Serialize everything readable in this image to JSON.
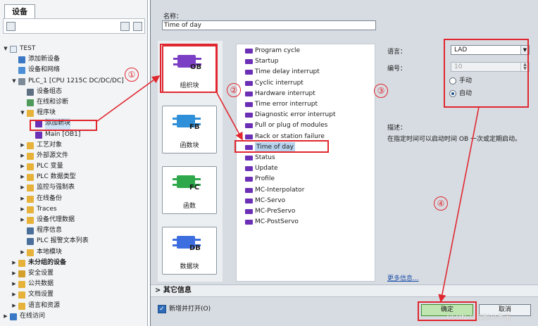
{
  "panel": {
    "title": "设备"
  },
  "tree": [
    {
      "label": "TEST",
      "arrow": "▼",
      "depth": 0,
      "icon": "project-icon"
    },
    {
      "label": "添加新设备",
      "arrow": "",
      "depth": 1,
      "icon": "add-device-icon"
    },
    {
      "label": "设备和网络",
      "arrow": "",
      "depth": 1,
      "icon": "network-icon"
    },
    {
      "label": "PLC_1 [CPU 1215C DC/DC/DC]",
      "arrow": "▼",
      "depth": 1,
      "icon": "plc-icon"
    },
    {
      "label": "设备组态",
      "arrow": "",
      "depth": 2,
      "icon": "device-config-icon"
    },
    {
      "label": "在线和诊断",
      "arrow": "",
      "depth": 2,
      "icon": "diagnostics-icon"
    },
    {
      "label": "程序块",
      "arrow": "▼",
      "depth": 2,
      "icon": "folder-icon"
    },
    {
      "label": "添加新块",
      "arrow": "",
      "depth": 3,
      "icon": "add-block-icon",
      "selected": true
    },
    {
      "label": "Main [OB1]",
      "arrow": "",
      "depth": 3,
      "icon": "ob-block-icon"
    },
    {
      "label": "工艺对象",
      "arrow": "▶",
      "depth": 2,
      "icon": "folder-icon"
    },
    {
      "label": "外部源文件",
      "arrow": "▶",
      "depth": 2,
      "icon": "folder-icon"
    },
    {
      "label": "PLC 变量",
      "arrow": "▶",
      "depth": 2,
      "icon": "folder-icon"
    },
    {
      "label": "PLC 数据类型",
      "arrow": "▶",
      "depth": 2,
      "icon": "folder-icon"
    },
    {
      "label": "监控与强制表",
      "arrow": "▶",
      "depth": 2,
      "icon": "folder-icon"
    },
    {
      "label": "在线备份",
      "arrow": "▶",
      "depth": 2,
      "icon": "folder-icon"
    },
    {
      "label": "Traces",
      "arrow": "▶",
      "depth": 2,
      "icon": "folder-icon"
    },
    {
      "label": "设备代理数据",
      "arrow": "▶",
      "depth": 2,
      "icon": "folder-icon"
    },
    {
      "label": "程序信息",
      "arrow": "",
      "depth": 2,
      "icon": "program-info-icon"
    },
    {
      "label": "PLC 报警文本列表",
      "arrow": "",
      "depth": 2,
      "icon": "alarm-list-icon"
    },
    {
      "label": "本地模块",
      "arrow": "▶",
      "depth": 2,
      "icon": "folder-icon"
    },
    {
      "label": "未分组的设备",
      "arrow": "▶",
      "depth": 1,
      "icon": "folder-icon",
      "bold": true
    },
    {
      "label": "安全设置",
      "arrow": "▶",
      "depth": 1,
      "icon": "security-icon"
    },
    {
      "label": "公共数据",
      "arrow": "▶",
      "depth": 1,
      "icon": "folder-icon"
    },
    {
      "label": "文档设置",
      "arrow": "▶",
      "depth": 1,
      "icon": "folder-icon"
    },
    {
      "label": "语言和资源",
      "arrow": "▶",
      "depth": 1,
      "icon": "folder-icon"
    },
    {
      "label": "在线访问",
      "arrow": "▶",
      "depth": 0,
      "icon": "online-access-icon"
    }
  ],
  "dialog": {
    "name_label": "名称：",
    "name_value": "Time of day",
    "block_types": [
      {
        "tag": "OB",
        "caption": "组织块",
        "color": "#7a3fc4",
        "icon": "ob-icon"
      },
      {
        "tag": "FB",
        "caption": "函数块",
        "color": "#2f8fd8",
        "icon": "fb-icon"
      },
      {
        "tag": "FC",
        "caption": "函数",
        "color": "#2ea84a",
        "icon": "fc-icon"
      },
      {
        "tag": "DB",
        "caption": "数据块",
        "color": "#3d6ee0",
        "icon": "db-icon"
      }
    ],
    "ob_list": [
      "Program cycle",
      "Startup",
      "Time delay interrupt",
      "Cyclic interrupt",
      "Hardware interrupt",
      "Time error interrupt",
      "Diagnostic error interrupt",
      "Pull or plug of modules",
      "Rack or station failure",
      "Time of day",
      "Status",
      "Update",
      "Profile",
      "MC-Interpolator",
      "MC-Servo",
      "MC-PreServo",
      "MC-PostServo"
    ],
    "selected_ob": "Time of day",
    "language_label": "语言：",
    "language_value": "LAD",
    "number_label": "编号：",
    "number_value": "10",
    "radio_manual": "手动",
    "radio_auto": "自动",
    "description_label": "描述：",
    "description_text": "在指定时间可以启动时间 OB 一次或定期启动。",
    "more_info": "更多信息...",
    "other_info": "其它信息",
    "add_open_label": "新增并打开(O)",
    "ok_label": "确定",
    "cancel_label": "取消"
  },
  "annotations": [
    "①",
    "②",
    "③",
    "④"
  ],
  "watermark": "CSDN @控制小宇宙"
}
